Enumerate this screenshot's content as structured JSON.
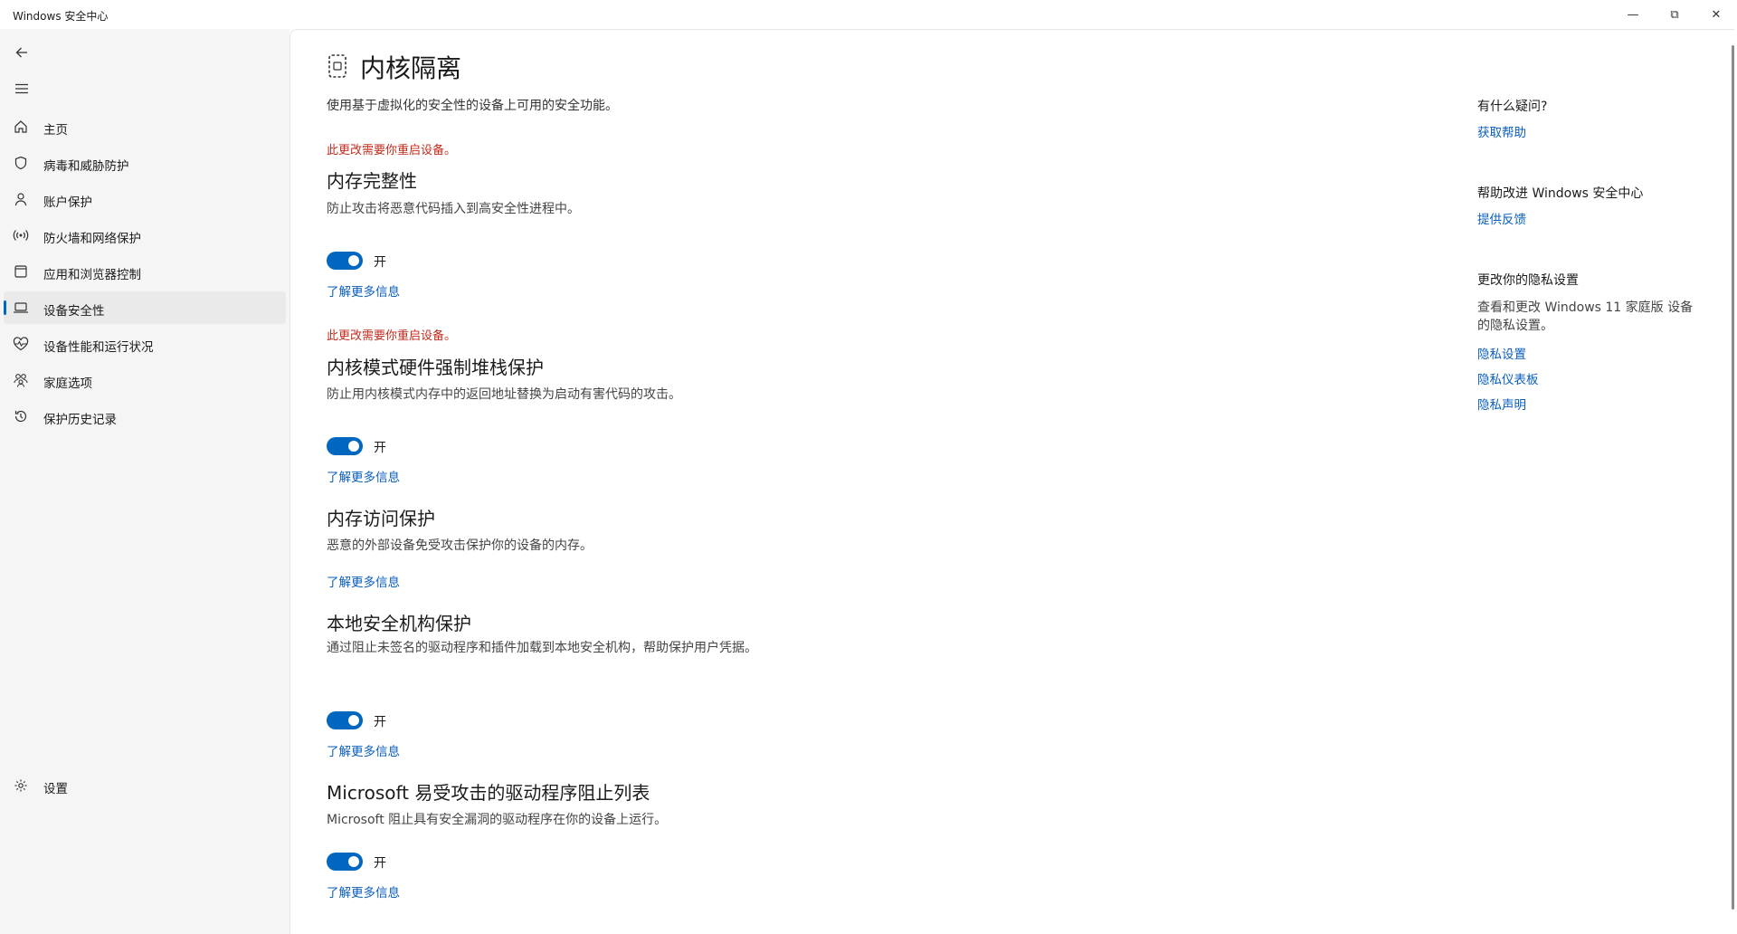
{
  "window": {
    "title": "Windows 安全中心",
    "minimize": "—",
    "maximize": "⧉",
    "close": "✕"
  },
  "sidebar": {
    "items": [
      {
        "label": "主页",
        "icon": "home-icon"
      },
      {
        "label": "病毒和威胁防护",
        "icon": "shield-icon"
      },
      {
        "label": "账户保护",
        "icon": "person-icon"
      },
      {
        "label": "防火墙和网络保护",
        "icon": "wireless-icon"
      },
      {
        "label": "应用和浏览器控制",
        "icon": "app-window-icon"
      },
      {
        "label": "设备安全性",
        "icon": "laptop-icon",
        "active": true
      },
      {
        "label": "设备性能和运行状况",
        "icon": "heart-pulse-icon"
      },
      {
        "label": "家庭选项",
        "icon": "family-icon"
      },
      {
        "label": "保护历史记录",
        "icon": "history-icon"
      }
    ],
    "settings_label": "设置"
  },
  "page": {
    "title": "内核隔离",
    "description": "使用基于虚拟化的安全性的设备上可用的安全功能。"
  },
  "sections": [
    {
      "warning": "此更改需要你重启设备。",
      "title": "内存完整性",
      "description": "防止攻击将恶意代码插入到高安全性进程中。",
      "toggle_on": true,
      "toggle_label": "开",
      "link": "了解更多信息"
    },
    {
      "warning": "此更改需要你重启设备。",
      "title": "内核模式硬件强制堆栈保护",
      "description": "防止用内核模式内存中的返回地址替换为启动有害代码的攻击。",
      "toggle_on": true,
      "toggle_label": "开",
      "link": "了解更多信息"
    },
    {
      "title": "内存访问保护",
      "description": "恶意的外部设备免受攻击保护你的设备的内存。",
      "link": "了解更多信息"
    },
    {
      "title": "本地安全机构保护",
      "description": "通过阻止未签名的驱动程序和插件加载到本地安全机构，帮助保护用户凭据。",
      "toggle_on": true,
      "toggle_label": "开",
      "link": "了解更多信息"
    },
    {
      "title": "Microsoft 易受攻击的驱动程序阻止列表",
      "description": "Microsoft 阻止具有安全漏洞的驱动程序在你的设备上运行。",
      "toggle_on": true,
      "toggle_label": "开",
      "link": "了解更多信息"
    }
  ],
  "right_pane": {
    "help_heading": "有什么疑问?",
    "help_link": "获取帮助",
    "improve_heading": "帮助改进 Windows 安全中心",
    "improve_link": "提供反馈",
    "privacy_heading": "更改你的隐私设置",
    "privacy_text": "查看和更改 Windows 11 家庭版 设备的隐私设置。",
    "privacy_links": [
      "隐私设置",
      "隐私仪表板",
      "隐私声明"
    ]
  },
  "colors": {
    "accent": "#0067c0",
    "link": "#0a5ebd",
    "warning": "#c42b1c"
  }
}
